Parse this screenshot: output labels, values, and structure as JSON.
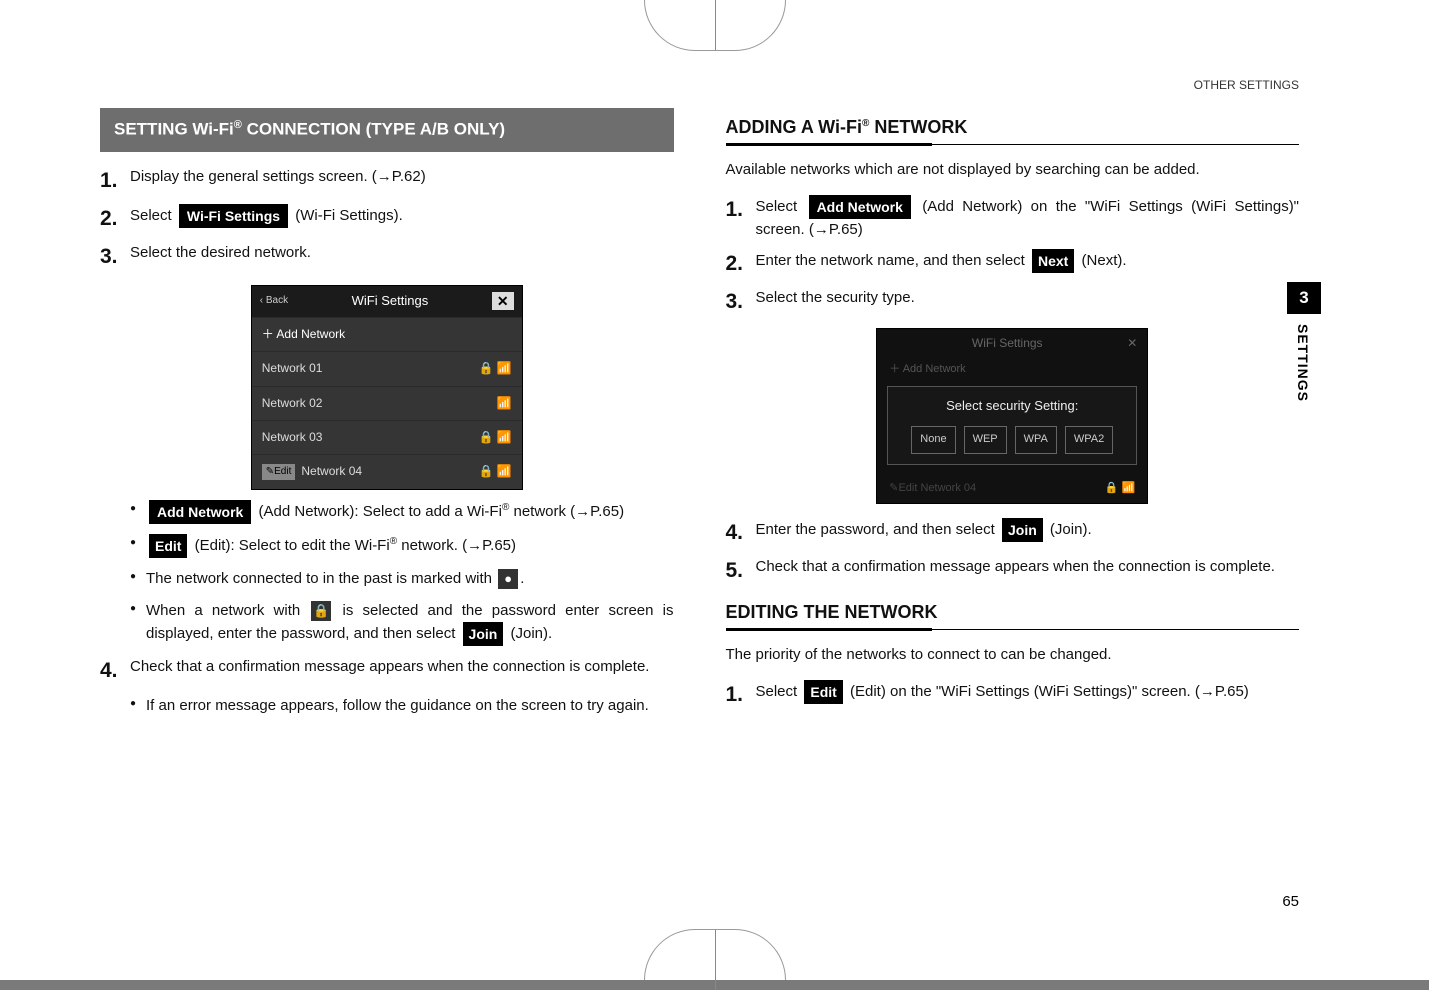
{
  "running_head": "OTHER SETTINGS",
  "tab": {
    "chapter": "3",
    "label": "SETTINGS"
  },
  "page_number": "65",
  "left": {
    "section_title_pre": "SETTING Wi-Fi",
    "section_title_post": " CONNECTION (TYPE A/B ONLY)",
    "steps": {
      "s1": "Display the general settings screen. (→P.62)",
      "s2_pre": "Select ",
      "s2_chip": "Wi-Fi Settings",
      "s2_post": " (Wi-Fi Settings).",
      "s3": "Select the desired network."
    },
    "shotA": {
      "back": "‹ Back",
      "title": "WiFi Settings",
      "close": "✕",
      "add": "＋  Add Network",
      "rows": [
        "Network 01",
        "Network 02",
        "Network 03",
        "Network 04"
      ],
      "edit_tag": "✎Edit"
    },
    "bullets": {
      "b1_chip": "Add Network",
      "b1_post": " (Add Network): Select to add a Wi-Fi",
      "b1_line2": "network (→P.65)",
      "b2_chip": "Edit",
      "b2_post": " (Edit): Select to edit the Wi-Fi",
      "b2_post2": " network. (→P.65)",
      "b3": "The network connected to in the past is marked with ",
      "b4_pre": "When a network with ",
      "b4_post": " is selected and the password enter screen is displayed, enter the password, and then select ",
      "b4_chip": "Join",
      "b4_end": " (Join)."
    },
    "step4": "Check that a confirmation message appears when the connection is complete.",
    "step4_sub": "If an error message appears, follow the guidance on the screen to try again."
  },
  "right": {
    "h_add_pre": "ADDING A Wi-Fi",
    "h_add_post": " NETWORK",
    "intro": "Available networks which are not displayed by searching can be added.",
    "s1_pre": "Select ",
    "s1_chip": "Add Network",
    "s1_post": " (Add Network) on the \"WiFi Settings (WiFi Settings)\" screen. (→P.65)",
    "s2_pre": "Enter the network name, and then select ",
    "s2_chip": "Next",
    "s2_post": " (Next).",
    "s3": "Select the security type.",
    "shotB": {
      "title": "WiFi Settings",
      "close": "✕",
      "dim": "＋  Add Network",
      "panel_label": "Select security Setting:",
      "opts": [
        "None",
        "WEP",
        "WPA",
        "WPA2"
      ],
      "foot_l": "✎Edit   Network 04"
    },
    "s4_pre": "Enter the password, and then select ",
    "s4_chip": "Join",
    "s4_post": " (Join).",
    "s5": "Check that a confirmation message appears when the connection is complete.",
    "h_edit": "EDITING THE NETWORK",
    "edit_intro": "The priority of the networks to connect to can be changed.",
    "e1_pre": "Select ",
    "e1_chip": "Edit",
    "e1_post": " (Edit) on the \"WiFi Settings (WiFi Settings)\" screen. (→P.65)"
  }
}
